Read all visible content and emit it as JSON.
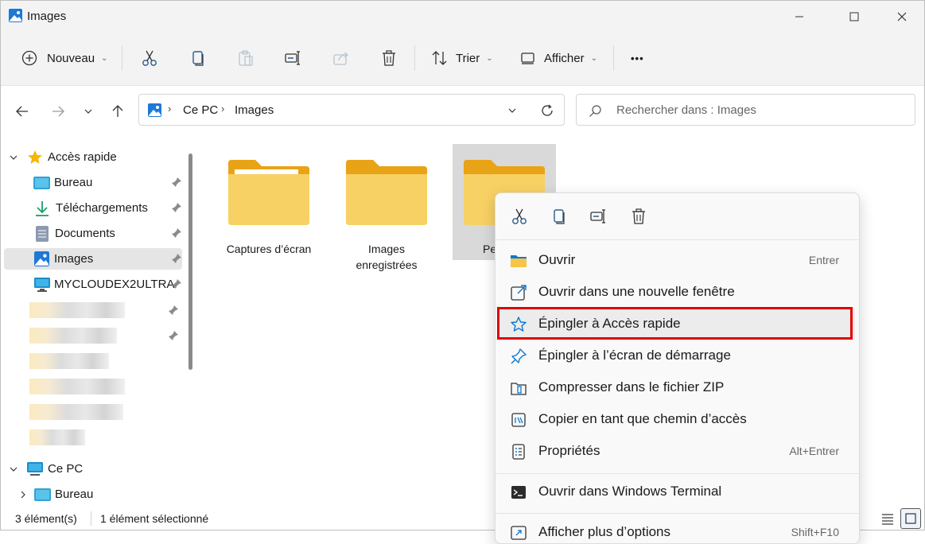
{
  "window": {
    "title": "Images"
  },
  "toolbar": {
    "new_label": "Nouveau",
    "sort_label": "Trier",
    "view_label": "Afficher",
    "more_label": "•••"
  },
  "address": {
    "crumbs": [
      "Ce PC",
      "Images"
    ],
    "search_placeholder": "Rechercher dans : Images"
  },
  "sidebar": {
    "quick_access": "Accès rapide",
    "items": [
      {
        "label": "Bureau"
      },
      {
        "label": "Téléchargements"
      },
      {
        "label": "Documents"
      },
      {
        "label": "Images"
      },
      {
        "label": "MYCLOUDEX2ULTRA"
      }
    ],
    "this_pc": "Ce PC",
    "this_pc_items": [
      {
        "label": "Bureau"
      }
    ]
  },
  "folders": [
    {
      "label": "Captures d’écran"
    },
    {
      "label": "Images enregistrées"
    },
    {
      "label": "Pe"
    }
  ],
  "status": {
    "count": "3 élément(s)",
    "selected": "1 élément sélectionné"
  },
  "context_menu": {
    "items": [
      {
        "label": "Ouvrir",
        "shortcut": "Entrer",
        "icon": "folder-icon"
      },
      {
        "label": "Ouvrir dans une nouvelle fenêtre",
        "shortcut": "",
        "icon": "open-new-window-icon"
      },
      {
        "label": "Épingler à Accès rapide",
        "shortcut": "",
        "icon": "star-icon"
      },
      {
        "label": "Épingler à l’écran de démarrage",
        "shortcut": "",
        "icon": "pin-icon"
      },
      {
        "label": "Compresser dans le fichier ZIP",
        "shortcut": "",
        "icon": "zip-icon"
      },
      {
        "label": "Copier en tant que chemin d’accès",
        "shortcut": "",
        "icon": "copy-path-icon"
      },
      {
        "label": "Propriétés",
        "shortcut": "Alt+Entrer",
        "icon": "properties-icon"
      },
      {
        "label": "Ouvrir dans Windows Terminal",
        "shortcut": "",
        "icon": "terminal-icon"
      },
      {
        "label": "Afficher plus d’options",
        "shortcut": "Shift+F10",
        "icon": "more-options-icon"
      }
    ]
  },
  "colors": {
    "accent": "#0067c0",
    "highlight": "#e00000",
    "folder": "#f8d164"
  }
}
